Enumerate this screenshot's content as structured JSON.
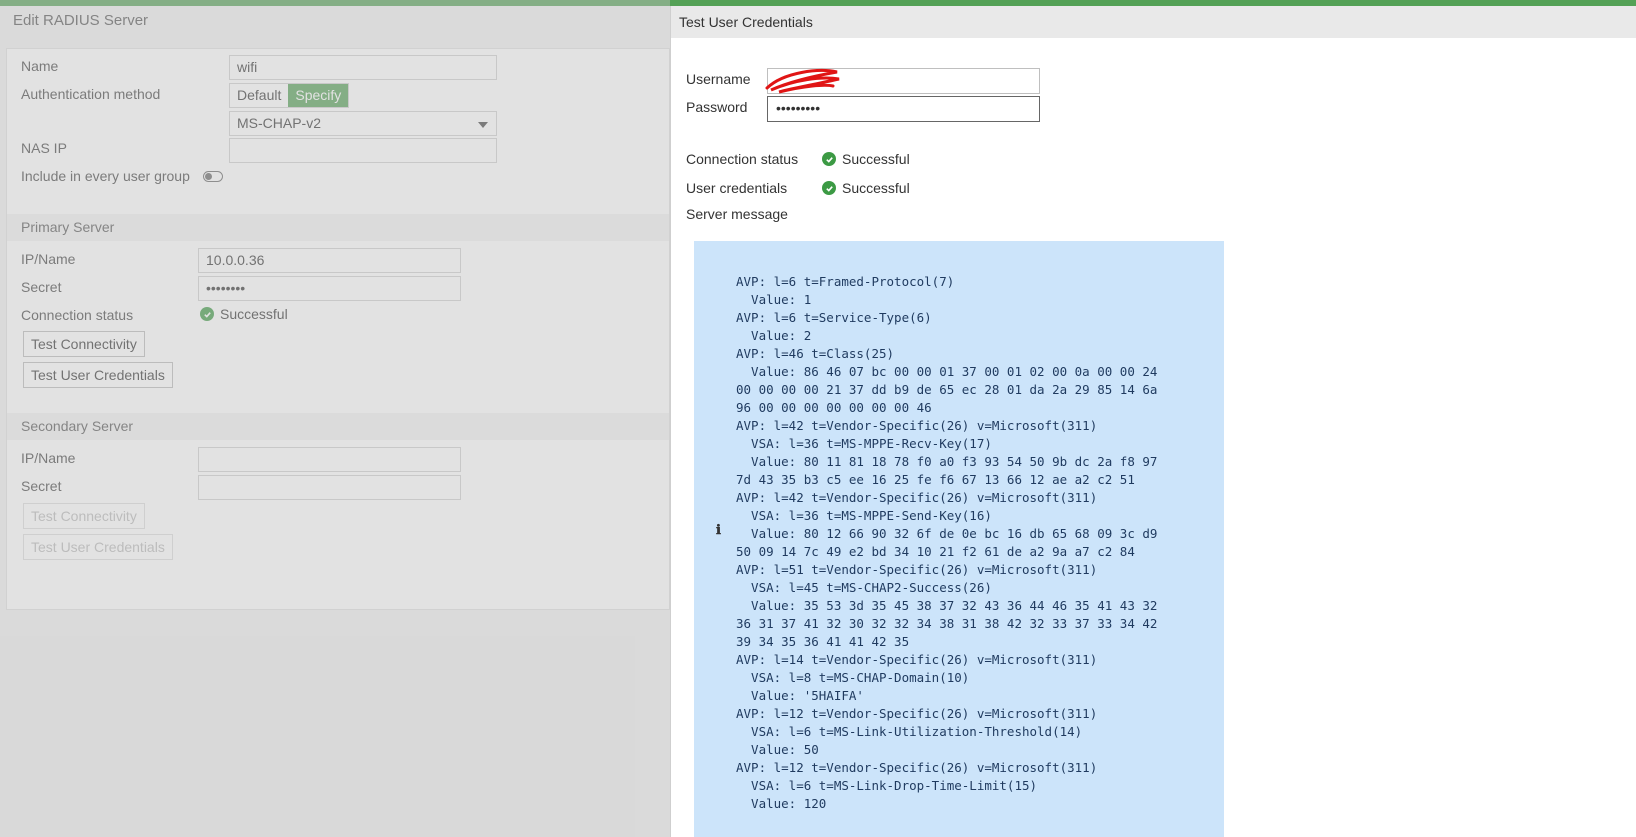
{
  "background_form": {
    "title": "Edit RADIUS Server",
    "name_label": "Name",
    "name_value": "wifi",
    "auth_method_label": "Authentication method",
    "auth_options": [
      "Default",
      "Specify"
    ],
    "auth_selected": "Specify",
    "auth_protocol": "MS-CHAP-v2",
    "nas_ip_label": "NAS IP",
    "nas_ip_value": "",
    "include_label": "Include in every user group",
    "primary": {
      "header": "Primary Server",
      "ip_label": "IP/Name",
      "ip_value": "10.0.0.36",
      "secret_label": "Secret",
      "secret_value": "••••••••",
      "connection_label": "Connection status",
      "connection_value": "Successful",
      "test_connectivity": "Test Connectivity",
      "test_credentials": "Test User Credentials"
    },
    "secondary": {
      "header": "Secondary Server",
      "ip_label": "IP/Name",
      "ip_value": "",
      "secret_label": "Secret",
      "secret_value": "",
      "test_connectivity": "Test Connectivity",
      "test_credentials": "Test User Credentials"
    }
  },
  "panel": {
    "title": "Test User Credentials",
    "username_label": "Username",
    "username_value": "",
    "password_label": "Password",
    "password_value": "•••••••••",
    "connection_status_label": "Connection status",
    "connection_status_value": "Successful",
    "user_credentials_label": "User credentials",
    "user_credentials_value": "Successful",
    "server_message_label": "Server message",
    "server_message": "AVP: l=6 t=Framed-Protocol(7)\n  Value: 1\nAVP: l=6 t=Service-Type(6)\n  Value: 2\nAVP: l=46 t=Class(25)\n  Value: 86 46 07 bc 00 00 01 37 00 01 02 00 0a 00 00 24\n00 00 00 00 21 37 dd b9 de 65 ec 28 01 da 2a 29 85 14 6a\n96 00 00 00 00 00 00 00 46\nAVP: l=42 t=Vendor-Specific(26) v=Microsoft(311)\n  VSA: l=36 t=MS-MPPE-Recv-Key(17)\n  Value: 80 11 81 18 78 f0 a0 f3 93 54 50 9b dc 2a f8 97\n7d 43 35 b3 c5 ee 16 25 fe f6 67 13 66 12 ae a2 c2 51\nAVP: l=42 t=Vendor-Specific(26) v=Microsoft(311)\n  VSA: l=36 t=MS-MPPE-Send-Key(16)\n  Value: 80 12 66 90 32 6f de 0e bc 16 db 65 68 09 3c d9\n50 09 14 7c 49 e2 bd 34 10 21 f2 61 de a2 9a a7 c2 84\nAVP: l=51 t=Vendor-Specific(26) v=Microsoft(311)\n  VSA: l=45 t=MS-CHAP2-Success(26)\n  Value: 35 53 3d 35 45 38 37 32 43 36 44 46 35 41 43 32\n36 31 37 41 32 30 32 32 34 38 31 38 42 32 33 37 33 34 42\n39 34 35 36 41 41 42 35\nAVP: l=14 t=Vendor-Specific(26) v=Microsoft(311)\n  VSA: l=8 t=MS-CHAP-Domain(10)\n  Value: '5HAIFA'\nAVP: l=12 t=Vendor-Specific(26) v=Microsoft(311)\n  VSA: l=6 t=MS-Link-Utilization-Threshold(14)\n  Value: 50\nAVP: l=12 t=Vendor-Specific(26) v=Microsoft(311)\n  VSA: l=6 t=MS-Link-Drop-Time-Limit(15)\n  Value: 120"
  },
  "colors": {
    "accent": "#54a156",
    "success": "#3c9a44",
    "message_bg": "#cce4fa"
  }
}
